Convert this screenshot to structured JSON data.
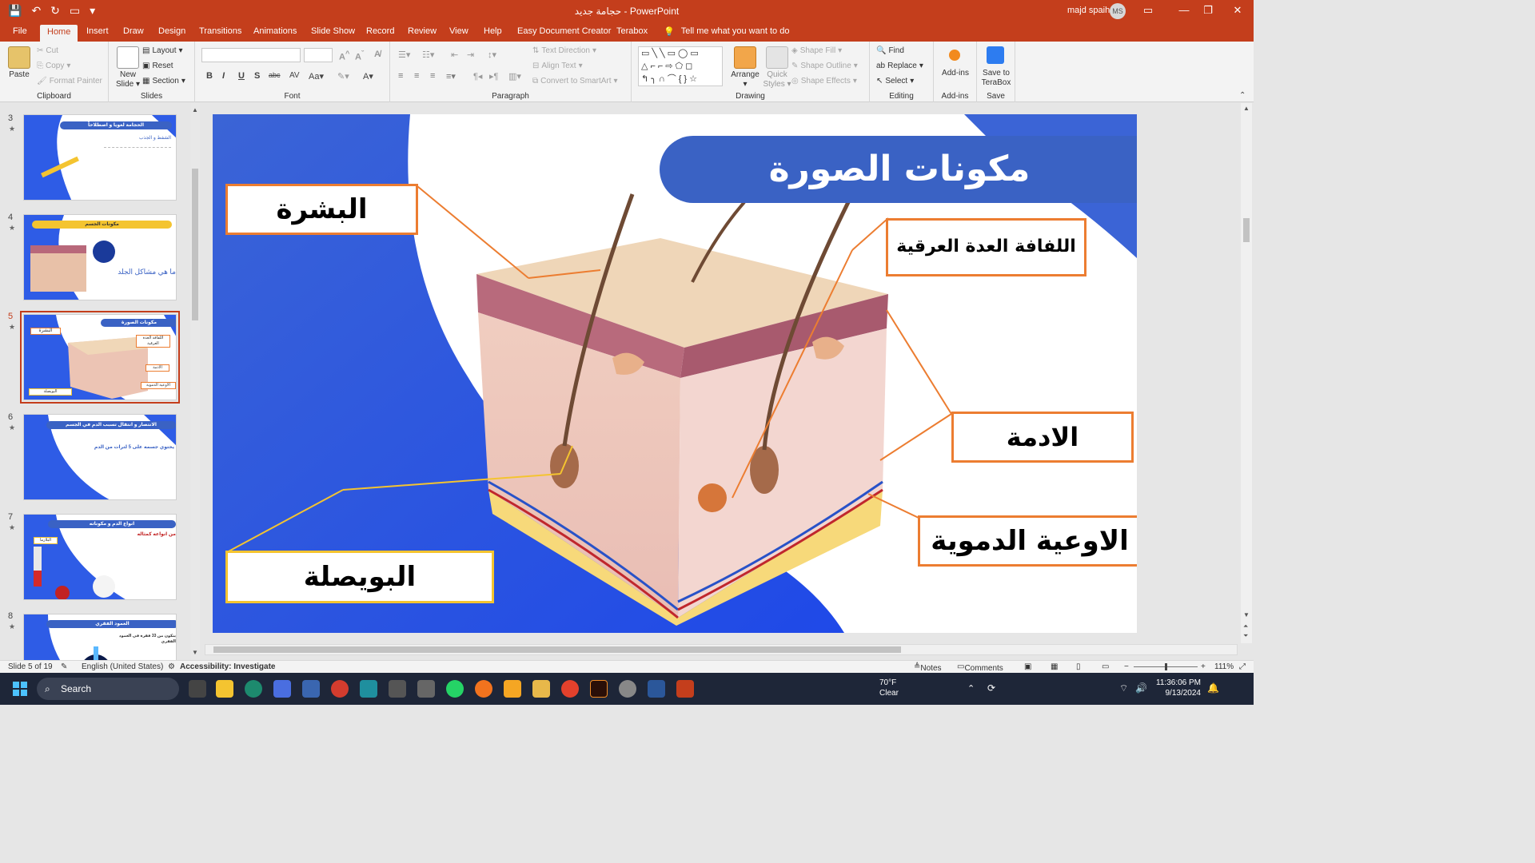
{
  "window": {
    "title": "حجامة جديد  -  PowerPoint",
    "user_name": "majd spaih",
    "user_initials": "MS"
  },
  "tabs": [
    "File",
    "Home",
    "Insert",
    "Draw",
    "Design",
    "Transitions",
    "Animations",
    "Slide Show",
    "Record",
    "Review",
    "View",
    "Help",
    "Easy Document Creator",
    "Terabox"
  ],
  "active_tab": "Home",
  "tell_me": "Tell me what you want to do",
  "ribbon": {
    "clipboard": {
      "label": "Clipboard",
      "paste": "Paste",
      "cut": "Cut",
      "copy": "Copy",
      "format_painter": "Format Painter"
    },
    "slides": {
      "label": "Slides",
      "new_slide_1": "New",
      "new_slide_2": "Slide",
      "layout": "Layout",
      "reset": "Reset",
      "section": "Section"
    },
    "font": {
      "label": "Font"
    },
    "paragraph": {
      "label": "Paragraph",
      "text_direction": "Text Direction",
      "align_text": "Align Text",
      "convert_smartart": "Convert to SmartArt"
    },
    "drawing": {
      "label": "Drawing",
      "arrange": "Arrange",
      "quick_1": "Quick",
      "quick_2": "Styles",
      "shape_fill": "Shape Fill",
      "shape_outline": "Shape Outline",
      "shape_effects": "Shape Effects"
    },
    "editing": {
      "label": "Editing",
      "find": "Find",
      "replace": "Replace",
      "select": "Select"
    },
    "addins": {
      "label": "Add-ins",
      "addins_btn": "Add-ins"
    },
    "save": {
      "label": "Save",
      "save_1": "Save to",
      "save_2": "TeraBox"
    }
  },
  "thumbnails": [
    {
      "num": "3",
      "title": "الحجامة لغويا و اصطلاحاً",
      "subtitle": "الشفط و الجذب"
    },
    {
      "num": "4",
      "title": "مكونات الجسم",
      "subtitle": "ما هي مشاكل الجلد"
    },
    {
      "num": "5",
      "title": "مكونات الصورة",
      "l1": "البشرة",
      "l2": "اللفافة العدة العرقية",
      "l3": "الادمة",
      "l4": "الاوعية الدموية",
      "l5": "البويصلة"
    },
    {
      "num": "6",
      "title": "الانتصار و انتقال تسبب الدم في الجسم",
      "subtitle": "يحتوي جسمه على 5 لترات من الدم"
    },
    {
      "num": "7",
      "title": "انواع الدم و مكوناته",
      "subtitle": "من انواعه كمثاله",
      "plasma": "البلازما"
    },
    {
      "num": "8",
      "title": "العمود الفقري",
      "subtitle": "يتكون من 33 فقرة في العمود الفقري"
    }
  ],
  "slide": {
    "title": "مكونات الصورة",
    "labels": {
      "epidermis": "البشرة",
      "sweat_gland": "اللفافة العدة العرقية",
      "dermis": "الادمة",
      "blood_vessels": "الاوعية الدموية",
      "follicle": "البويصلة"
    }
  },
  "status": {
    "slide_of": "Slide 5 of 19",
    "language": "English (United States)",
    "accessibility": "Accessibility: Investigate",
    "notes": "Notes",
    "comments": "Comments",
    "zoom": "111%"
  },
  "taskbar": {
    "search": "Search",
    "temp": "70°F",
    "weather": "Clear",
    "time": "11:36:06 PM",
    "date": "9/13/2024"
  }
}
